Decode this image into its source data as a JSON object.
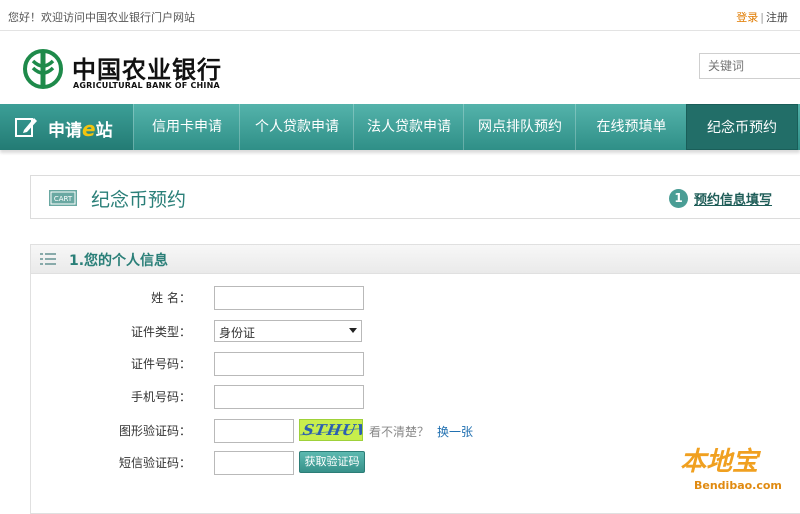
{
  "topbar": {
    "welcome": "您好！欢迎访问中国农业银行门户网站",
    "login": "登录",
    "separator": "|",
    "register": "注册"
  },
  "header": {
    "logo_cn": "中国农业银行",
    "logo_en": "AGRICULTURAL BANK OF CHINA",
    "search_placeholder": "关键词"
  },
  "nav": {
    "brand_prefix": "申请",
    "brand_e": "e",
    "brand_suffix": "站",
    "items": [
      {
        "label": "信用卡申请"
      },
      {
        "label": "个人贷款申请"
      },
      {
        "label": "法人贷款申请"
      },
      {
        "label": "网点排队预约"
      },
      {
        "label": "在线预填单"
      },
      {
        "label": "纪念币预约"
      }
    ]
  },
  "page": {
    "cart_icon_text": "CART",
    "title": "纪念币预约",
    "step_number": "1",
    "step_text": "预约信息填写"
  },
  "section": {
    "title": "1.您的个人信息",
    "fields": {
      "name_label": "姓 名：",
      "id_type_label": "证件类型：",
      "id_type_value": "身份证",
      "id_number_label": "证件号码：",
      "phone_label": "手机号码：",
      "captcha_label": "图形验证码：",
      "captcha_text": "STHUV",
      "captcha_hint": "看不清楚？",
      "captcha_refresh": "换一张",
      "sms_label": "短信验证码：",
      "sms_button": "获取验证码"
    }
  },
  "watermark": {
    "cn": "本地宝",
    "en": "Bendibao.com"
  },
  "colors": {
    "nav_teal": "#3a9f97",
    "nav_active": "#226e68",
    "title_teal": "#2a7f78",
    "login_orange": "#e07b00",
    "link_blue": "#1f6fb0"
  }
}
